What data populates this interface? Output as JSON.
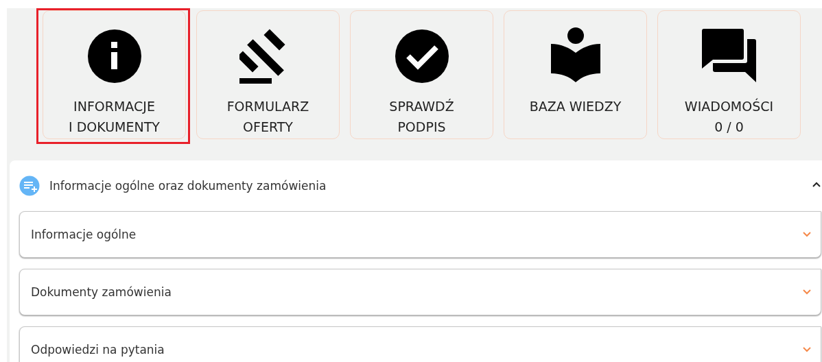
{
  "tiles": [
    {
      "label": "INFORMACJE\nI DOKUMENTY",
      "selected": true
    },
    {
      "label": "FORMULARZ\nOFERTY",
      "selected": false
    },
    {
      "label": "SPRAWDŹ\nPODPIS",
      "selected": false
    },
    {
      "label": "BAZA WIEDZY",
      "selected": false
    },
    {
      "label": "WIADOMOŚCI\n0 / 0",
      "selected": false
    }
  ],
  "section": {
    "title": "Informacje ogólne oraz dokumenty zamówienia",
    "expanded": true,
    "items": [
      {
        "label": "Informacje ogólne",
        "expanded": false
      },
      {
        "label": "Dokumenty zamówienia",
        "expanded": false
      },
      {
        "label": "Odpowiedzi na pytania",
        "expanded": false
      }
    ]
  }
}
